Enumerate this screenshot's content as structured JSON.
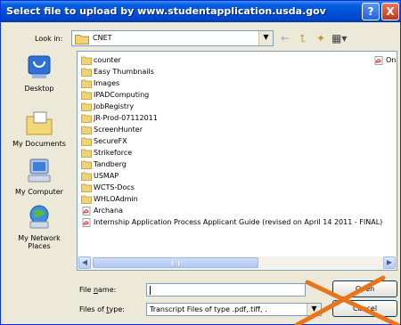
{
  "window": {
    "title": "Select file to upload by www.studentapplication.usda.gov",
    "help_glyph": "?",
    "close_glyph": "X"
  },
  "look_in": {
    "label": "Look in:",
    "value": "CNET"
  },
  "places": [
    {
      "label_line1": "Desktop",
      "label_line2": "",
      "icon": "desktop-icon"
    },
    {
      "label_line1": "My Documents",
      "label_line2": "",
      "icon": "my-documents-icon"
    },
    {
      "label_line1": "My Computer",
      "label_line2": "",
      "icon": "my-computer-icon"
    },
    {
      "label_line1": "My Network",
      "label_line2": "Places",
      "icon": "network-places-icon"
    }
  ],
  "files": [
    {
      "name": "counter",
      "type": "folder"
    },
    {
      "name": "Easy Thumbnails",
      "type": "folder"
    },
    {
      "name": "Images",
      "type": "folder"
    },
    {
      "name": "IPADComputing",
      "type": "folder"
    },
    {
      "name": "JobRegistry",
      "type": "folder"
    },
    {
      "name": "JR-Prod-07112011",
      "type": "folder"
    },
    {
      "name": "ScreenHunter",
      "type": "folder"
    },
    {
      "name": "SecureFX",
      "type": "folder"
    },
    {
      "name": "Strikeforce",
      "type": "folder"
    },
    {
      "name": "Tandberg",
      "type": "folder"
    },
    {
      "name": "USMAP",
      "type": "folder"
    },
    {
      "name": "WCTS-Docs",
      "type": "folder"
    },
    {
      "name": "WHLOAdmin",
      "type": "folder"
    },
    {
      "name": "Archana",
      "type": "pdf"
    },
    {
      "name": "Internship Application Process Applicant Guide (revised on April 14 2011 - FINAL)",
      "type": "pdf"
    }
  ],
  "files_column2": [
    {
      "name": "On",
      "type": "pdf"
    }
  ],
  "file_name": {
    "label_prefix": "File ",
    "label_key": "n",
    "label_suffix": "ame:",
    "value": ""
  },
  "file_type": {
    "label_prefix": "Files of ",
    "label_key": "t",
    "label_suffix": "ype:",
    "value": "Transcript Files of type .pdf,.tiff, ."
  },
  "buttons": {
    "open": "Open",
    "cancel": "Cancel"
  },
  "colors": {
    "title_bar": "#0052dc",
    "folder": "#f0d27a",
    "pdf": "#d42020",
    "cross": "#e8741c"
  }
}
